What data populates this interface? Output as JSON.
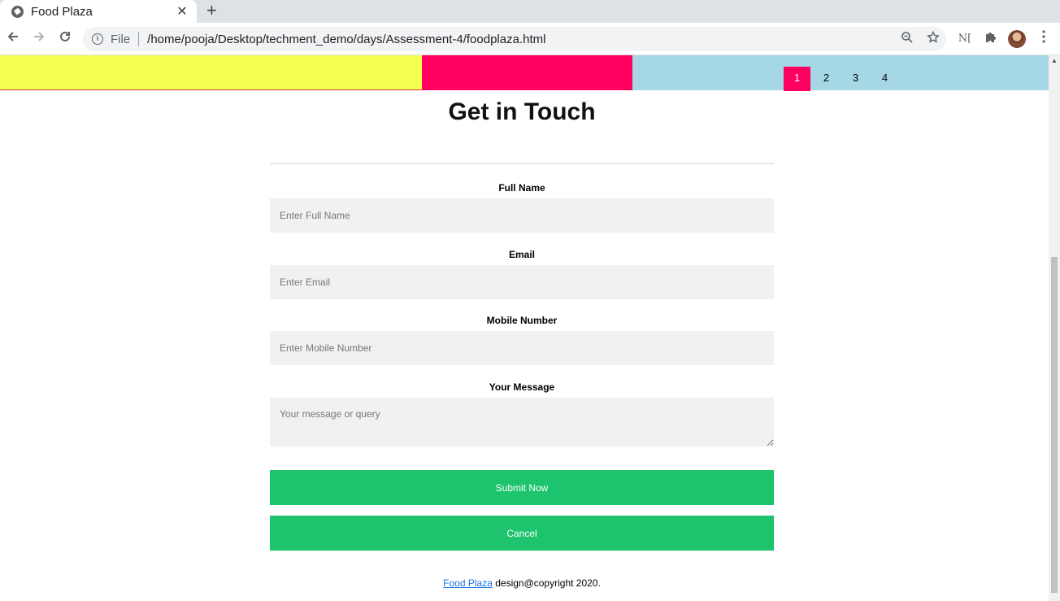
{
  "browser": {
    "tab_title": "Food Plaza",
    "tab_close": "✕",
    "new_tab": "+",
    "url_scheme": "File",
    "url": "/home/pooja/Desktop/techment_demo/days/Assessment-4/foodplaza.html",
    "ext_label": "N["
  },
  "header": {
    "pages": [
      "1",
      "2",
      "3",
      "4"
    ],
    "active_page": "1",
    "colors": {
      "yellow": "#f5ff52",
      "pink": "#ff0061",
      "blue": "#a5d8e4"
    }
  },
  "form": {
    "title": "Get in Touch",
    "full_name": {
      "label": "Full Name",
      "placeholder": "Enter Full Name"
    },
    "email": {
      "label": "Email",
      "placeholder": "Enter Email"
    },
    "mobile": {
      "label": "Mobile Number",
      "placeholder": "Enter Mobile Number"
    },
    "message": {
      "label": "Your Message",
      "placeholder": "Your message or query"
    },
    "submit_label": "Submit Now",
    "cancel_label": "Cancel",
    "button_color": "#1dc46d"
  },
  "footer": {
    "link_text": "Food Plaza",
    "text": "design@copyright 2020."
  }
}
